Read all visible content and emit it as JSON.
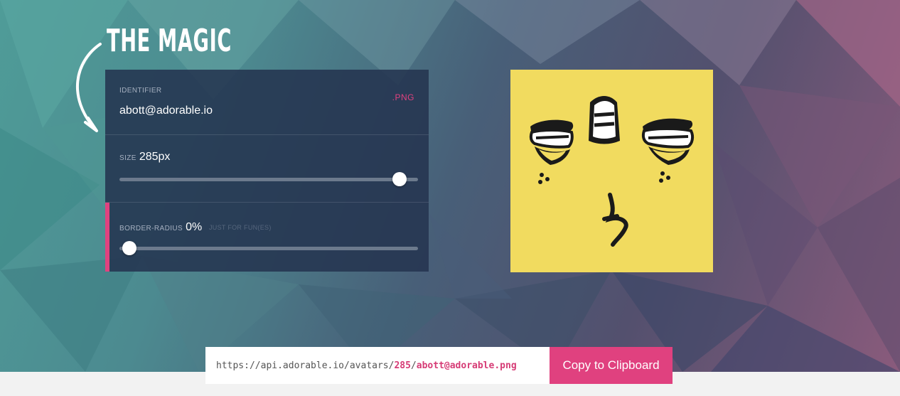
{
  "magic": {
    "title": "THE MAGIC"
  },
  "identifier": {
    "label": "IDENTIFIER",
    "value": "abott@adorable.io",
    "extension": ".PNG"
  },
  "size": {
    "label": "SIZE",
    "value": "285px",
    "slider_fraction": 0.96
  },
  "border_radius": {
    "label": "BORDER-RADIUS",
    "value": "0%",
    "hint": "JUST FOR FUN(ES)",
    "slider_fraction": 0.01
  },
  "url": {
    "prefix": "https://api.adorable.io/avatars/",
    "size": "285",
    "sep": "/",
    "id": "abott@adorable.png"
  },
  "copy_button": {
    "label": "Copy to Clipboard"
  },
  "colors": {
    "accent": "#e0417f",
    "panel": "#243450",
    "avatar_bg": "#f1db5f"
  }
}
